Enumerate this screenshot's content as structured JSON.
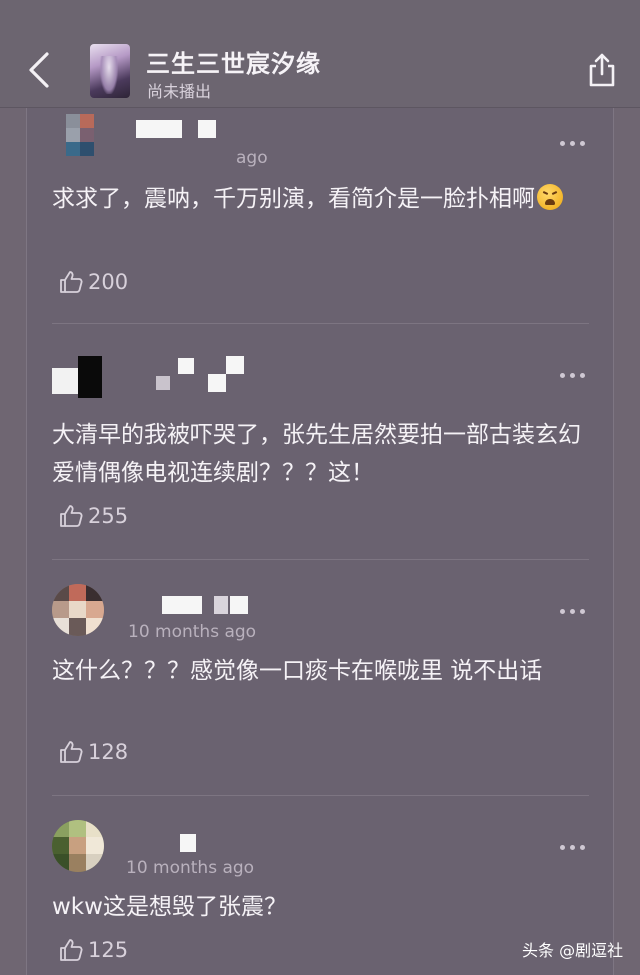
{
  "header": {
    "back_icon": "chevron-left-icon",
    "title": "三生三世宸汐缘",
    "status": "尚未播出",
    "share_icon": "share-icon"
  },
  "comments": [
    {
      "text": "求求了，震呐，千万别演，看简介是一脸扑相啊",
      "timestamp": "ago",
      "emoji": "tired-face-emoji",
      "likes": "200"
    },
    {
      "text": "大清早的我被吓哭了，张先生居然要拍一部古装玄幻爱情偶像电视连续剧？？？这！",
      "timestamp": "",
      "likes": "255"
    },
    {
      "text": "这什么？？？感觉像一口痰卡在喉咙里 说不出话",
      "timestamp": "10 months ago",
      "likes": "128"
    },
    {
      "text": "wkw这是想毁了张震？",
      "timestamp": "10 months ago",
      "likes": "125"
    }
  ],
  "watermark": {
    "text": "头条 @剧逗社"
  },
  "colors": {
    "background": "#6f6672",
    "panel": "#6a6270",
    "text": "#f5f2f6",
    "muted": "#b9b1bd"
  }
}
